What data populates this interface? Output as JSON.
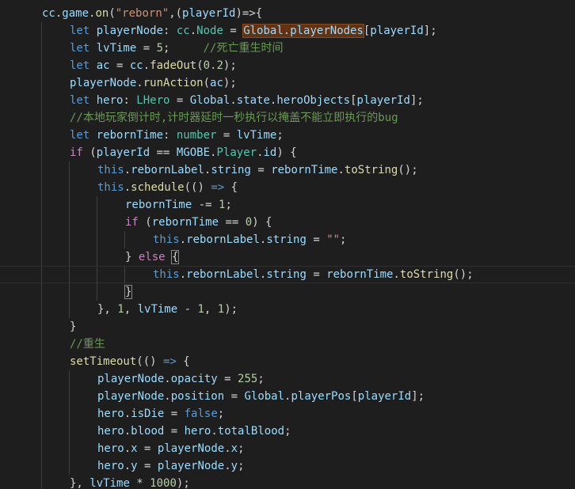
{
  "colors": {
    "background": "#1e1e1e",
    "plain": "#d4d4d4",
    "variable": "#9cdcfe",
    "keyword": "#569cd6",
    "control": "#c586c0",
    "function": "#dcdcaa",
    "string": "#ce9178",
    "number": "#b5cea8",
    "type": "#4ec9b0",
    "comment": "#6a9955",
    "word_highlight": "#613214"
  },
  "editor": {
    "current_line": 15,
    "lines": [
      {
        "indent": 1,
        "tokens": [
          [
            "cc",
            "var"
          ],
          [
            ".",
            "plain"
          ],
          [
            "game",
            "var"
          ],
          [
            ".",
            "plain"
          ],
          [
            "on",
            "fn"
          ],
          [
            "(",
            "plain"
          ],
          [
            "\"reborn\"",
            "str"
          ],
          [
            ",(",
            "plain"
          ],
          [
            "playerId",
            "var"
          ],
          [
            ")=>{",
            "plain"
          ]
        ]
      },
      {
        "indent": 2,
        "tokens": [
          [
            "let ",
            "kw"
          ],
          [
            "playerNode",
            "var"
          ],
          [
            ": ",
            "plain"
          ],
          [
            "cc",
            "type"
          ],
          [
            ".",
            "plain"
          ],
          [
            "Node",
            "type"
          ],
          [
            " = ",
            "plain"
          ],
          [
            "Global.playerNodes",
            "var",
            "hl"
          ],
          [
            "[",
            "plain"
          ],
          [
            "playerId",
            "var"
          ],
          [
            "];",
            "plain"
          ]
        ]
      },
      {
        "indent": 2,
        "tokens": [
          [
            "let ",
            "kw"
          ],
          [
            "lvTime",
            "var"
          ],
          [
            " = ",
            "plain"
          ],
          [
            "5",
            "num"
          ],
          [
            ";     ",
            "plain"
          ],
          [
            "//死亡重生时间",
            "cmt"
          ]
        ]
      },
      {
        "indent": 2,
        "tokens": [
          [
            "let ",
            "kw"
          ],
          [
            "ac",
            "var"
          ],
          [
            " = ",
            "plain"
          ],
          [
            "cc",
            "var"
          ],
          [
            ".",
            "plain"
          ],
          [
            "fadeOut",
            "fn"
          ],
          [
            "(",
            "plain"
          ],
          [
            "0.2",
            "num"
          ],
          [
            ");",
            "plain"
          ]
        ]
      },
      {
        "indent": 2,
        "tokens": [
          [
            "playerNode",
            "var"
          ],
          [
            ".",
            "plain"
          ],
          [
            "runAction",
            "fn"
          ],
          [
            "(",
            "plain"
          ],
          [
            "ac",
            "var"
          ],
          [
            ");",
            "plain"
          ]
        ]
      },
      {
        "indent": 2,
        "tokens": [
          [
            "let ",
            "kw"
          ],
          [
            "hero",
            "var"
          ],
          [
            ": ",
            "plain"
          ],
          [
            "LHero",
            "type"
          ],
          [
            " = ",
            "plain"
          ],
          [
            "Global",
            "var"
          ],
          [
            ".",
            "plain"
          ],
          [
            "state",
            "var"
          ],
          [
            ".",
            "plain"
          ],
          [
            "heroObjects",
            "var"
          ],
          [
            "[",
            "plain"
          ],
          [
            "playerId",
            "var"
          ],
          [
            "];",
            "plain"
          ]
        ]
      },
      {
        "indent": 2,
        "tokens": [
          [
            "//本地玩家倒计时,计时器延时一秒执行以掩盖不能立即执行的bug",
            "cmt"
          ]
        ]
      },
      {
        "indent": 2,
        "tokens": [
          [
            "let ",
            "kw"
          ],
          [
            "rebornTime",
            "var"
          ],
          [
            ": ",
            "plain"
          ],
          [
            "number",
            "type"
          ],
          [
            " = ",
            "plain"
          ],
          [
            "lvTime",
            "var"
          ],
          [
            ";",
            "plain"
          ]
        ]
      },
      {
        "indent": 2,
        "tokens": [
          [
            "if ",
            "ctl"
          ],
          [
            "(",
            "plain"
          ],
          [
            "playerId",
            "var"
          ],
          [
            " == ",
            "plain"
          ],
          [
            "MGOBE",
            "var"
          ],
          [
            ".",
            "plain"
          ],
          [
            "Player",
            "type"
          ],
          [
            ".",
            "plain"
          ],
          [
            "id",
            "var"
          ],
          [
            ") {",
            "plain"
          ]
        ]
      },
      {
        "indent": 3,
        "tokens": [
          [
            "this",
            "kw"
          ],
          [
            ".",
            "plain"
          ],
          [
            "rebornLabel",
            "var"
          ],
          [
            ".",
            "plain"
          ],
          [
            "string",
            "var"
          ],
          [
            " = ",
            "plain"
          ],
          [
            "rebornTime",
            "var"
          ],
          [
            ".",
            "plain"
          ],
          [
            "toString",
            "fn"
          ],
          [
            "();",
            "plain"
          ]
        ]
      },
      {
        "indent": 3,
        "tokens": [
          [
            "this",
            "kw"
          ],
          [
            ".",
            "plain"
          ],
          [
            "schedule",
            "fn"
          ],
          [
            "(() ",
            "plain"
          ],
          [
            "=>",
            "kw"
          ],
          [
            " {",
            "plain"
          ]
        ]
      },
      {
        "indent": 4,
        "tokens": [
          [
            "rebornTime",
            "var"
          ],
          [
            " -= ",
            "plain"
          ],
          [
            "1",
            "num"
          ],
          [
            ";",
            "plain"
          ]
        ]
      },
      {
        "indent": 4,
        "tokens": [
          [
            "if ",
            "ctl"
          ],
          [
            "(",
            "plain"
          ],
          [
            "rebornTime",
            "var"
          ],
          [
            " == ",
            "plain"
          ],
          [
            "0",
            "num"
          ],
          [
            ") {",
            "plain"
          ]
        ]
      },
      {
        "indent": 5,
        "tokens": [
          [
            "this",
            "kw"
          ],
          [
            ".",
            "plain"
          ],
          [
            "rebornLabel",
            "var"
          ],
          [
            ".",
            "plain"
          ],
          [
            "string",
            "var"
          ],
          [
            " = ",
            "plain"
          ],
          [
            "\"\"",
            "str"
          ],
          [
            ";",
            "plain"
          ]
        ]
      },
      {
        "indent": 4,
        "tokens": [
          [
            "} ",
            "plain"
          ],
          [
            "else ",
            "ctl"
          ],
          [
            "{",
            "plain",
            "box"
          ]
        ]
      },
      {
        "indent": 5,
        "tokens": [
          [
            "this",
            "kw"
          ],
          [
            ".",
            "plain"
          ],
          [
            "rebornLabel",
            "var"
          ],
          [
            ".",
            "plain"
          ],
          [
            "string",
            "var"
          ],
          [
            " = ",
            "plain"
          ],
          [
            "rebornTime",
            "var"
          ],
          [
            ".",
            "plain"
          ],
          [
            "toString",
            "fn"
          ],
          [
            "();",
            "plain"
          ]
        ]
      },
      {
        "indent": 4,
        "tokens": [
          [
            "}",
            "plain",
            "box"
          ]
        ]
      },
      {
        "indent": 3,
        "tokens": [
          [
            "}, ",
            "plain"
          ],
          [
            "1",
            "num"
          ],
          [
            ", ",
            "plain"
          ],
          [
            "lvTime",
            "var"
          ],
          [
            " - ",
            "plain"
          ],
          [
            "1",
            "num"
          ],
          [
            ", ",
            "plain"
          ],
          [
            "1",
            "num"
          ],
          [
            ");",
            "plain"
          ]
        ]
      },
      {
        "indent": 2,
        "tokens": [
          [
            "}",
            "plain"
          ]
        ]
      },
      {
        "indent": 2,
        "tokens": [
          [
            "//重生",
            "cmt"
          ]
        ]
      },
      {
        "indent": 2,
        "tokens": [
          [
            "setTimeout",
            "fn"
          ],
          [
            "(() ",
            "plain"
          ],
          [
            "=>",
            "kw"
          ],
          [
            " {",
            "plain"
          ]
        ]
      },
      {
        "indent": 3,
        "tokens": [
          [
            "playerNode",
            "var"
          ],
          [
            ".",
            "plain"
          ],
          [
            "opacity",
            "var"
          ],
          [
            " = ",
            "plain"
          ],
          [
            "255",
            "num"
          ],
          [
            ";",
            "plain"
          ]
        ]
      },
      {
        "indent": 3,
        "tokens": [
          [
            "playerNode",
            "var"
          ],
          [
            ".",
            "plain"
          ],
          [
            "position",
            "var"
          ],
          [
            " = ",
            "plain"
          ],
          [
            "Global",
            "var"
          ],
          [
            ".",
            "plain"
          ],
          [
            "playerPos",
            "var"
          ],
          [
            "[",
            "plain"
          ],
          [
            "playerId",
            "var"
          ],
          [
            "];",
            "plain"
          ]
        ]
      },
      {
        "indent": 3,
        "tokens": [
          [
            "hero",
            "var"
          ],
          [
            ".",
            "plain"
          ],
          [
            "isDie",
            "var"
          ],
          [
            " = ",
            "plain"
          ],
          [
            "false",
            "kw"
          ],
          [
            ";",
            "plain"
          ]
        ]
      },
      {
        "indent": 3,
        "tokens": [
          [
            "hero",
            "var"
          ],
          [
            ".",
            "plain"
          ],
          [
            "blood",
            "var"
          ],
          [
            " = ",
            "plain"
          ],
          [
            "hero",
            "var"
          ],
          [
            ".",
            "plain"
          ],
          [
            "totalBlood",
            "var"
          ],
          [
            ";",
            "plain"
          ]
        ]
      },
      {
        "indent": 3,
        "tokens": [
          [
            "hero",
            "var"
          ],
          [
            ".",
            "plain"
          ],
          [
            "x",
            "var"
          ],
          [
            " = ",
            "plain"
          ],
          [
            "playerNode",
            "var"
          ],
          [
            ".",
            "plain"
          ],
          [
            "x",
            "var"
          ],
          [
            ";",
            "plain"
          ]
        ]
      },
      {
        "indent": 3,
        "tokens": [
          [
            "hero",
            "var"
          ],
          [
            ".",
            "plain"
          ],
          [
            "y",
            "var"
          ],
          [
            " = ",
            "plain"
          ],
          [
            "playerNode",
            "var"
          ],
          [
            ".",
            "plain"
          ],
          [
            "y",
            "var"
          ],
          [
            ";",
            "plain"
          ]
        ]
      },
      {
        "indent": 2,
        "tokens": [
          [
            "}, ",
            "plain"
          ],
          [
            "lvTime",
            "var"
          ],
          [
            " * ",
            "plain"
          ],
          [
            "1000",
            "num"
          ],
          [
            ");",
            "plain"
          ]
        ]
      }
    ]
  }
}
